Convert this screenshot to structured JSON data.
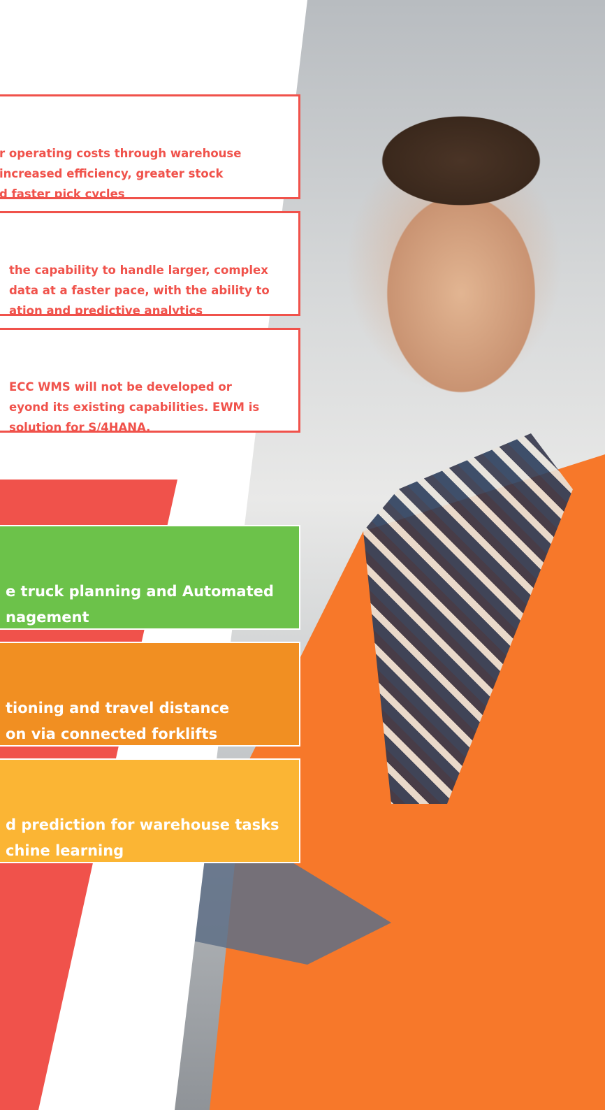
{
  "benefits": [
    {
      "text": "r operating costs through warehouse\n increased efficiency, greater stock\nd faster pick cycles"
    },
    {
      "text": "the capability to handle larger, complex\ndata at a faster pace, with the ability to\nation and predictive analytics"
    },
    {
      "text": " ECC WMS will not be developed or\neyond its existing capabilities. EWM is\n solution for S/4HANA."
    }
  ],
  "features": [
    {
      "text": "e truck planning and Automated\nnagement",
      "color": "#6cc24a"
    },
    {
      "text": "tioning and travel distance\non via connected forklifts",
      "color": "#f18f22"
    },
    {
      "text": "d prediction for warehouse tasks\nchine learning",
      "color": "#fbb534"
    }
  ],
  "colors": {
    "accent_red": "#f0524b",
    "green": "#6cc24a",
    "orange": "#f18f22",
    "yellow": "#fbb534"
  }
}
